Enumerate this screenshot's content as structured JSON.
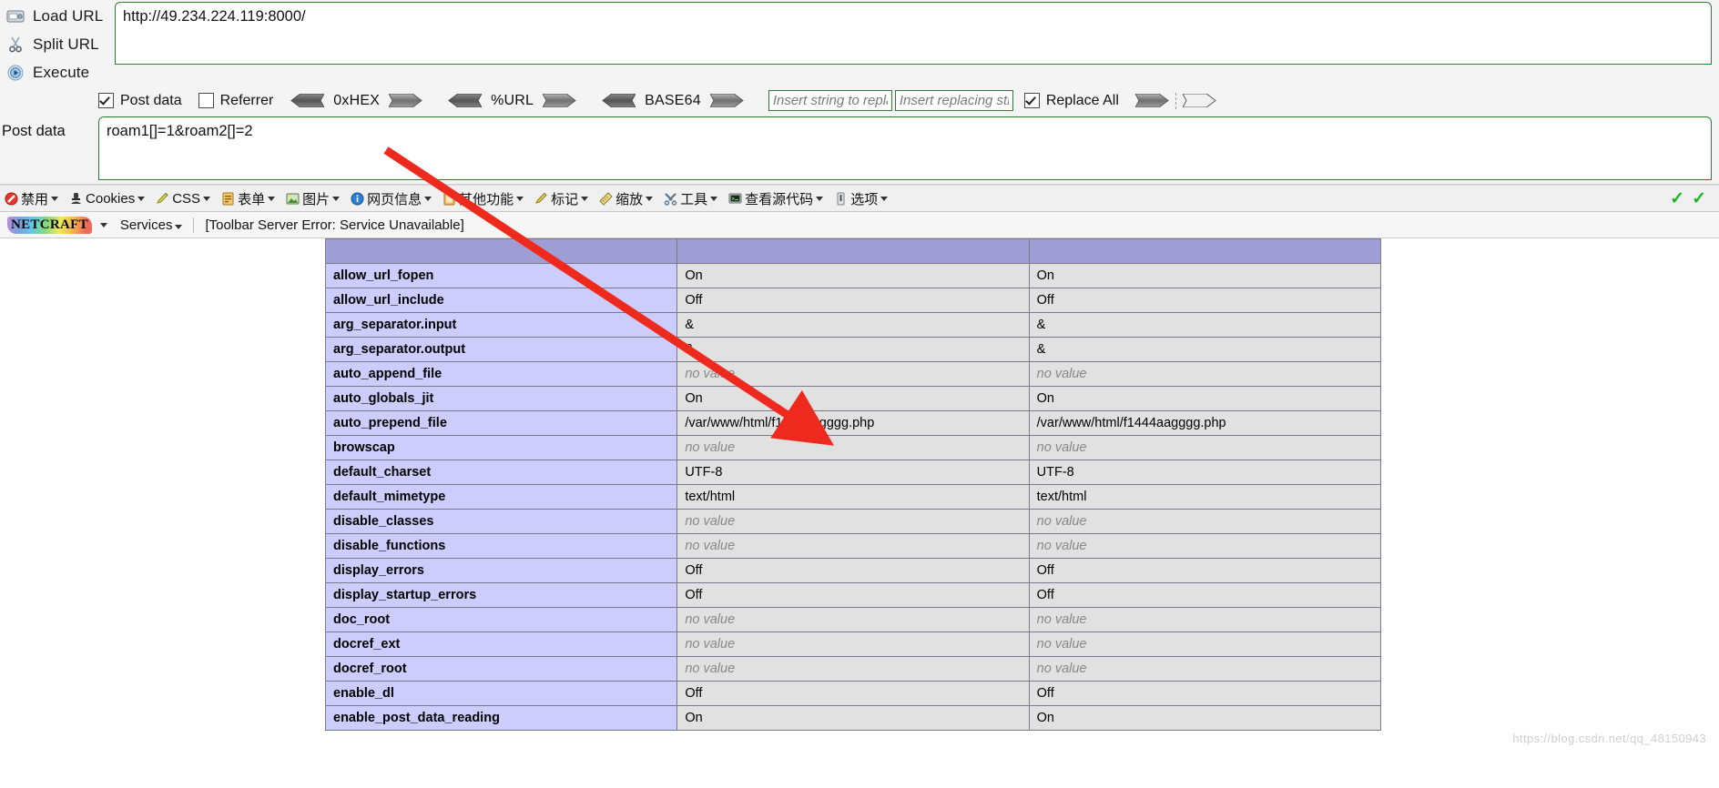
{
  "hackbar": {
    "actions": [
      {
        "icon": "load-url-icon",
        "label": "Load URL"
      },
      {
        "icon": "split-url-icon",
        "label": "Split URL"
      },
      {
        "icon": "execute-icon",
        "label": "Execute"
      }
    ],
    "url_value": "http://49.234.224.119:8000/",
    "post_data_label": "Post data",
    "post_data_value": "roam1[]=1&roam2[]=2",
    "options": {
      "post_data": {
        "label": "Post data",
        "checked": true
      },
      "referrer": {
        "label": "Referrer",
        "checked": false
      },
      "replace_all": {
        "label": "Replace All",
        "checked": true
      }
    },
    "encoders": [
      {
        "label": "0xHEX"
      },
      {
        "label": "%URL"
      },
      {
        "label": "BASE64"
      }
    ],
    "replace_from_placeholder": "Insert string to replace",
    "replace_to_placeholder": "Insert replacing string"
  },
  "devtoolbar": {
    "items": [
      {
        "icon": "disable-icon",
        "label": "禁用"
      },
      {
        "icon": "cookies-icon",
        "label": "Cookies"
      },
      {
        "icon": "css-icon",
        "label": "CSS"
      },
      {
        "icon": "forms-icon",
        "label": "表单"
      },
      {
        "icon": "images-icon",
        "label": "图片"
      },
      {
        "icon": "info-icon",
        "label": "网页信息"
      },
      {
        "icon": "misc-icon",
        "label": "其他功能"
      },
      {
        "icon": "outline-icon",
        "label": "标记"
      },
      {
        "icon": "resize-icon",
        "label": "缩放"
      },
      {
        "icon": "tools-icon",
        "label": "工具"
      },
      {
        "icon": "viewsource-icon",
        "label": "查看源代码"
      },
      {
        "icon": "options-icon",
        "label": "选项"
      }
    ],
    "right_icons": [
      "check-icon",
      "check-icon"
    ]
  },
  "netcraft": {
    "logo": "NETCRAFT",
    "services": "Services",
    "status": "[Toolbar Server Error: Service Unavailable]"
  },
  "phpinfo": {
    "rows": [
      {
        "name": "allow_url_fopen",
        "local": "On",
        "master": "On",
        "local_novalue": false,
        "master_novalue": false
      },
      {
        "name": "allow_url_include",
        "local": "Off",
        "master": "Off",
        "local_novalue": false,
        "master_novalue": false
      },
      {
        "name": "arg_separator.input",
        "local": "&",
        "master": "&",
        "local_novalue": false,
        "master_novalue": false
      },
      {
        "name": "arg_separator.output",
        "local": "&",
        "master": "&",
        "local_novalue": false,
        "master_novalue": false
      },
      {
        "name": "auto_append_file",
        "local": "no value",
        "master": "no value",
        "local_novalue": true,
        "master_novalue": true
      },
      {
        "name": "auto_globals_jit",
        "local": "On",
        "master": "On",
        "local_novalue": false,
        "master_novalue": false
      },
      {
        "name": "auto_prepend_file",
        "local": "/var/www/html/f1444aagggg.php",
        "master": "/var/www/html/f1444aagggg.php",
        "local_novalue": false,
        "master_novalue": false
      },
      {
        "name": "browscap",
        "local": "no value",
        "master": "no value",
        "local_novalue": true,
        "master_novalue": true
      },
      {
        "name": "default_charset",
        "local": "UTF-8",
        "master": "UTF-8",
        "local_novalue": false,
        "master_novalue": false
      },
      {
        "name": "default_mimetype",
        "local": "text/html",
        "master": "text/html",
        "local_novalue": false,
        "master_novalue": false
      },
      {
        "name": "disable_classes",
        "local": "no value",
        "master": "no value",
        "local_novalue": true,
        "master_novalue": true
      },
      {
        "name": "disable_functions",
        "local": "no value",
        "master": "no value",
        "local_novalue": true,
        "master_novalue": true
      },
      {
        "name": "display_errors",
        "local": "Off",
        "master": "Off",
        "local_novalue": false,
        "master_novalue": false
      },
      {
        "name": "display_startup_errors",
        "local": "Off",
        "master": "Off",
        "local_novalue": false,
        "master_novalue": false
      },
      {
        "name": "doc_root",
        "local": "no value",
        "master": "no value",
        "local_novalue": true,
        "master_novalue": true
      },
      {
        "name": "docref_ext",
        "local": "no value",
        "master": "no value",
        "local_novalue": true,
        "master_novalue": true
      },
      {
        "name": "docref_root",
        "local": "no value",
        "master": "no value",
        "local_novalue": true,
        "master_novalue": true
      },
      {
        "name": "enable_dl",
        "local": "Off",
        "master": "Off",
        "local_novalue": false,
        "master_novalue": false
      },
      {
        "name": "enable_post_data_reading",
        "local": "On",
        "master": "On",
        "local_novalue": false,
        "master_novalue": false
      }
    ]
  },
  "watermark": "https://blog.csdn.net/qq_48150943",
  "colors": {
    "accent_green": "#2e7d32",
    "table_name_bg": "#cccdfc",
    "table_value_bg": "#e1e1e1",
    "table_header_bg": "#9e9ed4",
    "arrow_red": "#ee2a1e"
  }
}
